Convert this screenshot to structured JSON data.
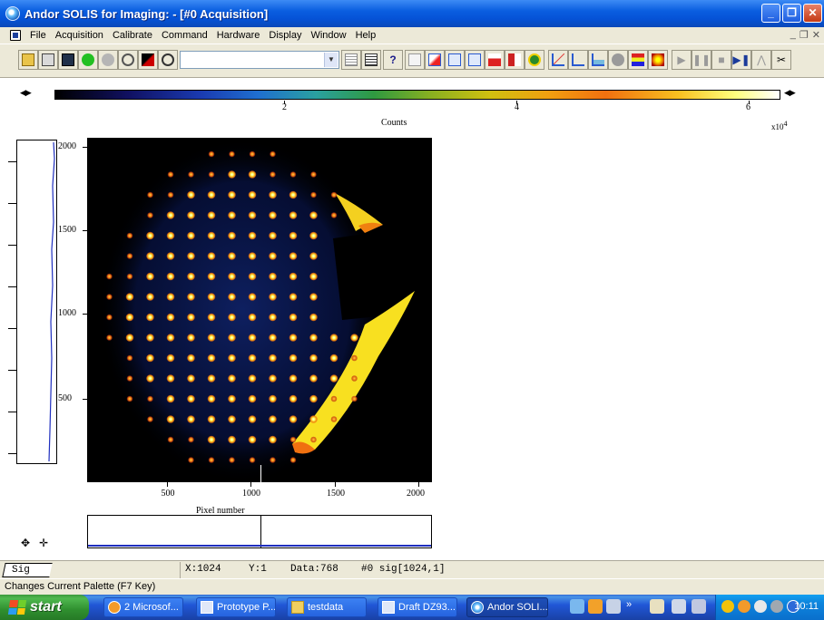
{
  "window": {
    "title": "Andor SOLIS for Imaging: - [#0  Acquisition]",
    "minimize": "_",
    "restore": "❐",
    "close": "✕"
  },
  "menu": {
    "items": [
      "File",
      "Acquisition",
      "Calibrate",
      "Command",
      "Hardware",
      "Display",
      "Window",
      "Help"
    ],
    "mdi_controls": [
      "_",
      "❐",
      "✕"
    ]
  },
  "toolbar": {
    "combo_value": "",
    "help_label": "?"
  },
  "palette": {
    "tick_labels": [
      "2",
      "4",
      "6"
    ],
    "counts_label": "Counts",
    "exponent_label": "x10",
    "exponent_power": "4"
  },
  "image": {
    "y_labels": [
      "2000",
      "1500",
      "1000",
      "500"
    ],
    "x_labels": [
      "500",
      "1000",
      "1500",
      "2000"
    ],
    "x_axis_label": "Pixel number",
    "colors": {
      "background": "#000000",
      "spot_core": "#ffff60",
      "spot_edge": "#f07a10",
      "halo": "#1a3ab0"
    }
  },
  "status_line": {
    "tab": "Sig",
    "x": "X:1024",
    "y": "Y:1",
    "data": "Data:768",
    "signal": "#0 sig[1024,1]"
  },
  "status_bar": {
    "message": "Changes Current Palette (F7 Key)"
  },
  "taskbar": {
    "start": "start",
    "tasks": [
      "2 Microsof...",
      "Prototype P...",
      "testdata",
      "Draft DZ93...",
      "Andor SOLI..."
    ],
    "overflow": "»",
    "clock": "10:11"
  }
}
